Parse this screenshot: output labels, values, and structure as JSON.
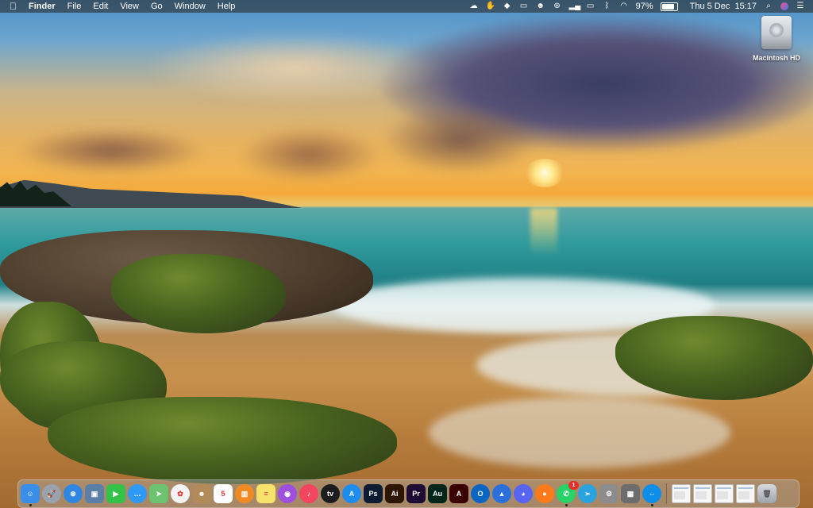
{
  "menubar": {
    "apple_icon": "apple-icon",
    "app_name": "Finder",
    "menus": [
      "File",
      "Edit",
      "View",
      "Go",
      "Window",
      "Help"
    ],
    "status_icons": [
      "creative-cloud-icon",
      "hand-icon",
      "dropbox-icon",
      "screenshot-icon",
      "face-icon",
      "cloud-icon",
      "signal-icon",
      "airplay-icon",
      "bluetooth-icon",
      "wifi-icon"
    ],
    "battery_percent": "97%",
    "battery_level": 0.97,
    "clock": "Thu 5 Dec  15:17",
    "spotlight_icon": "spotlight-search-icon",
    "siri_icon": "siri-icon",
    "notification_icon": "notification-center-icon"
  },
  "desktop": {
    "hd_label": "Macintosh HD"
  },
  "dock": {
    "apps": [
      {
        "name": "finder",
        "color": "#3b8ee8",
        "glyph": "☺",
        "running": true
      },
      {
        "name": "launchpad",
        "color": "#9aa3ad",
        "glyph": "🚀",
        "running": false
      },
      {
        "name": "safari",
        "color": "#2f86e3",
        "glyph": "⊕",
        "running": false
      },
      {
        "name": "preview",
        "color": "#5c7fa8",
        "glyph": "▣",
        "running": false
      },
      {
        "name": "facetime",
        "color": "#35c249",
        "glyph": "▶",
        "running": false
      },
      {
        "name": "messages",
        "color": "#2f9af5",
        "glyph": "…",
        "running": false
      },
      {
        "name": "maps",
        "color": "#6cc26f",
        "glyph": "➤",
        "running": false
      },
      {
        "name": "photos",
        "color": "#f3f3f3",
        "glyph": "✿",
        "running": false
      },
      {
        "name": "contacts",
        "color": "#b38b5a",
        "glyph": "☻",
        "running": false
      },
      {
        "name": "calendar",
        "color": "#ffffff",
        "glyph": "5",
        "running": false
      },
      {
        "name": "books",
        "color": "#f08a24",
        "glyph": "▥",
        "running": false
      },
      {
        "name": "notes",
        "color": "#f7e36b",
        "glyph": "≡",
        "running": false
      },
      {
        "name": "podcasts",
        "color": "#9e4fe0",
        "glyph": "◉",
        "running": false
      },
      {
        "name": "music",
        "color": "#f44560",
        "glyph": "♪",
        "running": false
      },
      {
        "name": "apple-tv",
        "color": "#1c1c1e",
        "glyph": "tv",
        "running": false
      },
      {
        "name": "app-store",
        "color": "#1e8df0",
        "glyph": "A",
        "running": false
      },
      {
        "name": "photoshop",
        "color": "#0c1d33",
        "glyph": "Ps",
        "running": false
      },
      {
        "name": "illustrator",
        "color": "#2e1500",
        "glyph": "Ai",
        "running": false
      },
      {
        "name": "premiere",
        "color": "#1e0b33",
        "glyph": "Pr",
        "running": false
      },
      {
        "name": "audition",
        "color": "#00261c",
        "glyph": "Au",
        "running": false
      },
      {
        "name": "acrobat",
        "color": "#3a0000",
        "glyph": "A",
        "running": false
      },
      {
        "name": "outlook",
        "color": "#0a66c2",
        "glyph": "O",
        "running": false
      },
      {
        "name": "telegram-navigator",
        "color": "#2a6fdb",
        "glyph": "▲",
        "running": false
      },
      {
        "name": "discord",
        "color": "#5865f2",
        "glyph": "◕",
        "running": false
      },
      {
        "name": "firefox",
        "color": "#ff7a1a",
        "glyph": "●",
        "running": false
      },
      {
        "name": "whatsapp",
        "color": "#25d366",
        "glyph": "✆",
        "running": true,
        "badge": "1"
      },
      {
        "name": "telegram",
        "color": "#2aa3e0",
        "glyph": "➣",
        "running": false
      },
      {
        "name": "system-preferences",
        "color": "#8c8c8c",
        "glyph": "⚙",
        "running": false
      },
      {
        "name": "calculator-app",
        "color": "#6d6d6d",
        "glyph": "▦",
        "running": false
      },
      {
        "name": "teamviewer",
        "color": "#0e8ee9",
        "glyph": "⇔",
        "running": true
      }
    ],
    "minimized_windows": [
      "minimized-window-1",
      "minimized-window-2",
      "minimized-window-3",
      "minimized-window-4"
    ],
    "trash_icon": "trash-icon"
  }
}
